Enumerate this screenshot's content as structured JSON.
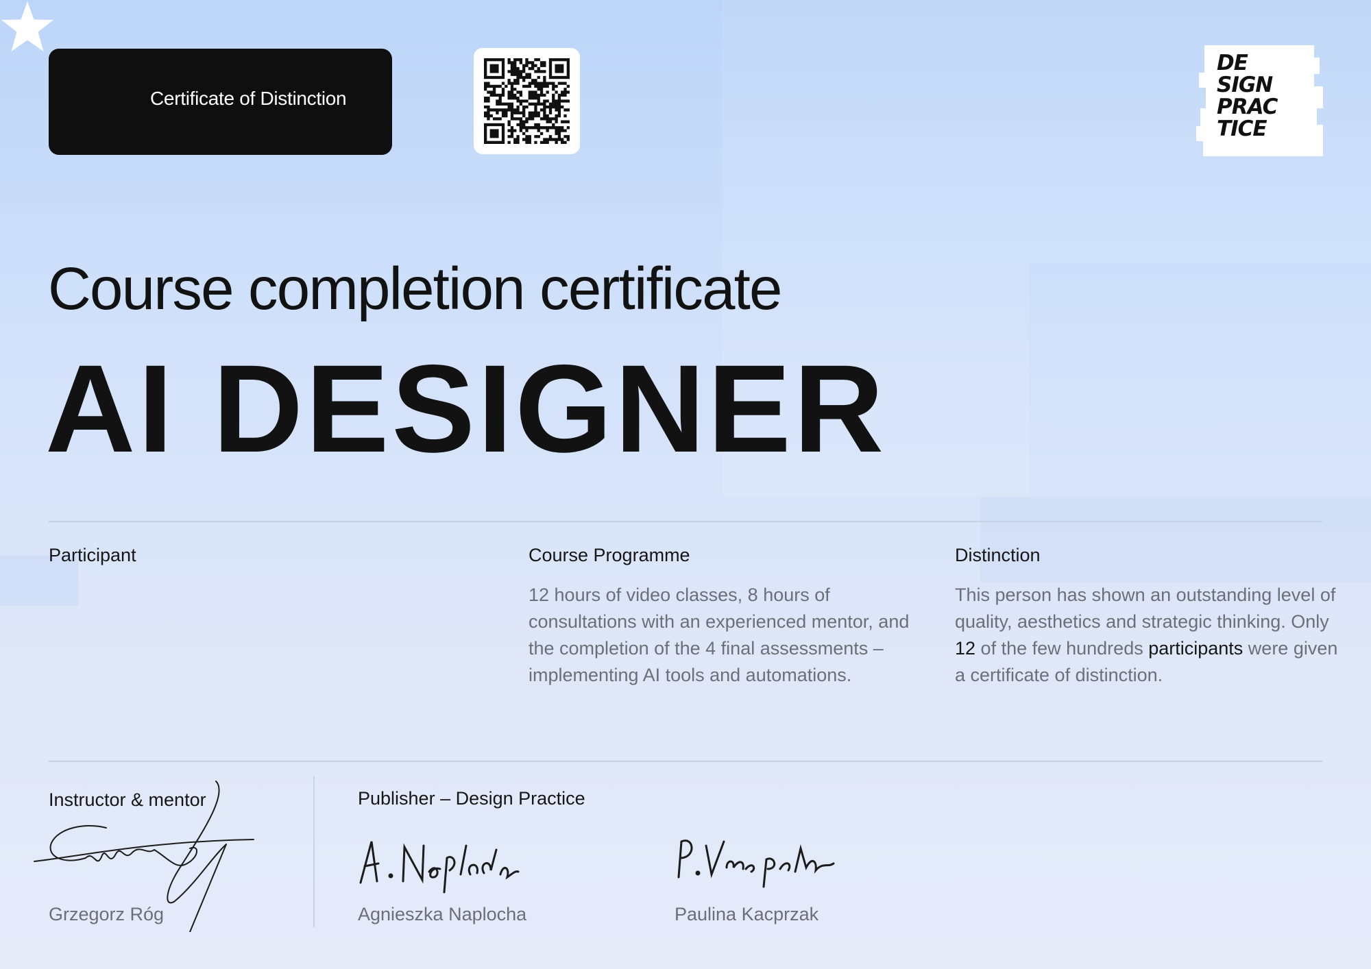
{
  "colors": {
    "badge_bg": "#0f0f0f",
    "text_dark": "#151515",
    "text_muted": "#6c6f78",
    "background_top": "#bcd5f9",
    "background_bottom": "#e5ebf9"
  },
  "badge": {
    "icon": "star-icon",
    "label": "Certificate of Distinction"
  },
  "qr_code": {
    "icon": "qr-code"
  },
  "logo": {
    "text": "DE\nSIGN\nPRAC\nTICE"
  },
  "subtitle": "Course completion certificate",
  "course_title": "AI DESIGNER",
  "participant": {
    "heading": "Participant"
  },
  "programme": {
    "heading": "Course Programme",
    "body": "12 hours of video classes, 8 hours of consultations with an experienced mentor, and the completion of the 4 final assessments – implementing AI tools and automations."
  },
  "distinction": {
    "heading": "Distinction",
    "body_1": "This person has shown an outstanding level of quality, aesthetics and strategic thinking. Only ",
    "body_count": "12",
    "body_2": " of the few hundreds ",
    "body_emph": "participants",
    "body_3": " were given a certificate of distinction."
  },
  "instructor": {
    "heading": "Instructor & mentor",
    "name": "Grzegorz Róg"
  },
  "publisher": {
    "heading": "Publisher – Design Practice",
    "signer_1": "Agnieszka Naplocha",
    "signer_2": "Paulina Kacprzak"
  }
}
